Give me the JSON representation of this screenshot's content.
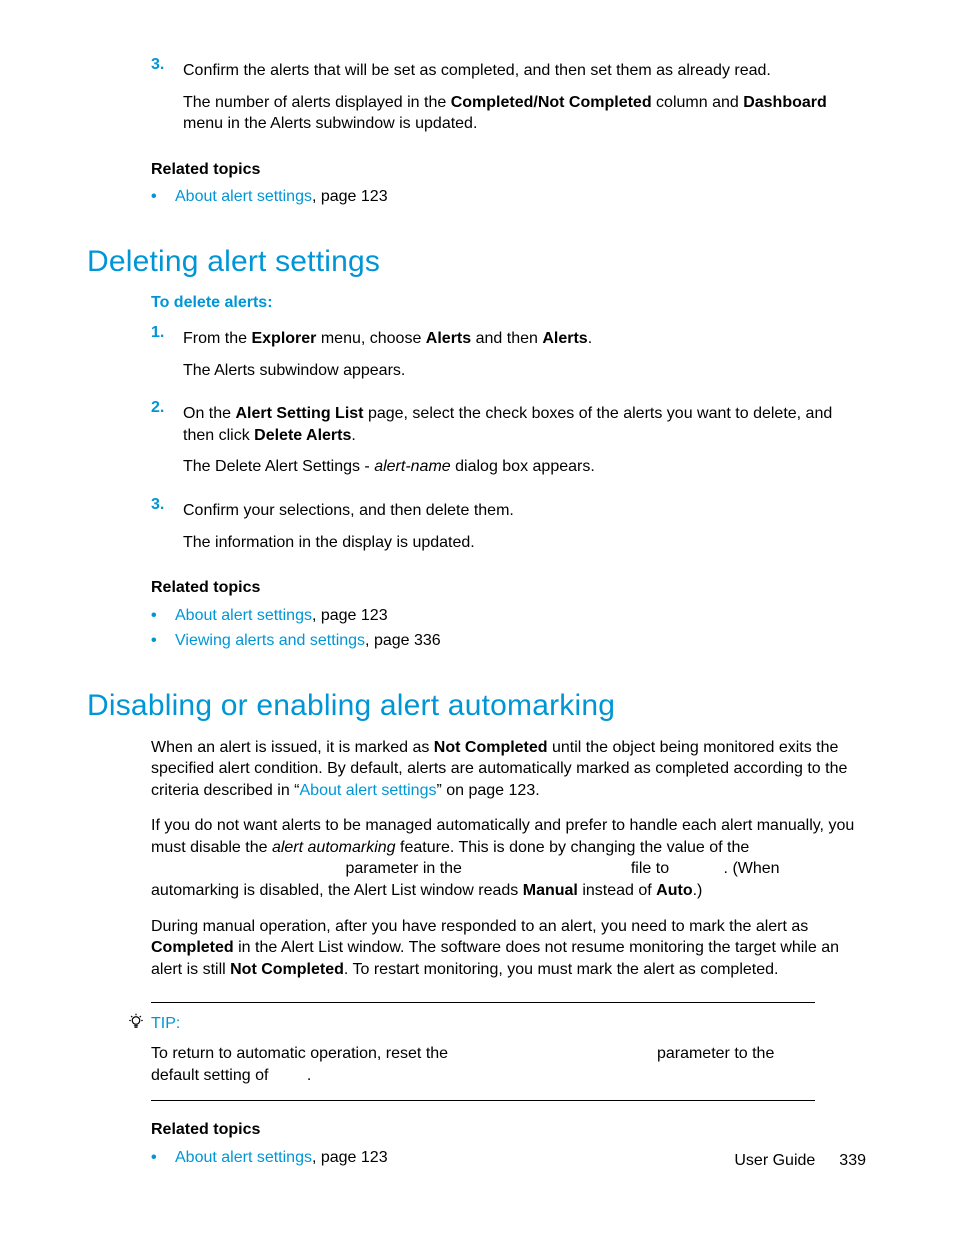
{
  "top": {
    "step3": {
      "num": "3.",
      "text": "Confirm the alerts that will be set as completed, and then set them as already read.",
      "sub_pre": "The number of alerts displayed in the ",
      "sub_b1": "Completed/Not Completed",
      "sub_mid": " column and ",
      "sub_b2": "Dashboard",
      "sub_post": " menu in the Alerts subwindow is updated."
    },
    "related_heading": "Related topics",
    "related": [
      {
        "link": "About alert settings",
        "rest": ", page 123"
      }
    ]
  },
  "deleting": {
    "heading": "Deleting alert settings",
    "proc_heading": "To delete alerts:",
    "steps": {
      "s1": {
        "num": "1.",
        "t1": "From the ",
        "b1": "Explorer",
        "t2": " menu, choose ",
        "b2": "Alerts",
        "t3": " and then ",
        "b3": "Alerts",
        "t4": ".",
        "sub": "The Alerts subwindow appears."
      },
      "s2": {
        "num": "2.",
        "t1": "On the ",
        "b1": "Alert Setting List",
        "t2": " page, select the check boxes of the alerts you want to delete, and then click ",
        "b2": "Delete Alerts",
        "t3": ".",
        "sub_pre": "The Delete Alert Settings - ",
        "sub_i": "alert-name",
        "sub_post": " dialog box appears."
      },
      "s3": {
        "num": "3.",
        "text": "Confirm your selections, and then delete them.",
        "sub": "The information in the display is updated."
      }
    },
    "related_heading": "Related topics",
    "related": [
      {
        "link": "About alert settings",
        "rest": ", page 123"
      },
      {
        "link": "Viewing alerts and settings",
        "rest": ", page 336"
      }
    ]
  },
  "disabling": {
    "heading": "Disabling or enabling alert automarking",
    "p1": {
      "t1": "When an alert is issued, it is marked as ",
      "b1": "Not Completed",
      "t2": " until the object being monitored exits the specified alert condition. By default, alerts are automatically marked as completed according to the criteria described in “",
      "link": "About alert settings",
      "t3": "” on page 123."
    },
    "p2": {
      "t1": "If you do not want alerts to be managed automatically and prefer to handle each alert manually, you must disable the ",
      "i1": "alert automarking",
      "t2": " feature. This is done by changing the value of the ",
      "gap1": "",
      "t3": " parameter in the ",
      "gap2": "",
      "t4": " file to ",
      "gap3": "",
      "t5": ". (When automarking is disabled, the Alert List window reads ",
      "b1": "Manual",
      "t6": " instead of ",
      "b2": "Auto",
      "t7": ".)"
    },
    "p3": {
      "t1": "During manual operation, after you have responded to an alert, you need to mark the alert as ",
      "b1": "Completed",
      "t2": " in the Alert List window. The software does not resume monitoring the target while an alert is still ",
      "b2": "Not Completed",
      "t3": ". To restart monitoring, you must mark the alert as completed."
    },
    "tip": {
      "label": "TIP:",
      "t1": "To return to automatic operation, reset the ",
      "gap1": "",
      "t2": " parameter to the default setting of ",
      "gap2": "",
      "t3": "."
    },
    "related_heading": "Related topics",
    "related": [
      {
        "link": "About alert settings",
        "rest": ", page 123"
      }
    ]
  },
  "footer": {
    "label": "User Guide",
    "page": "339"
  }
}
